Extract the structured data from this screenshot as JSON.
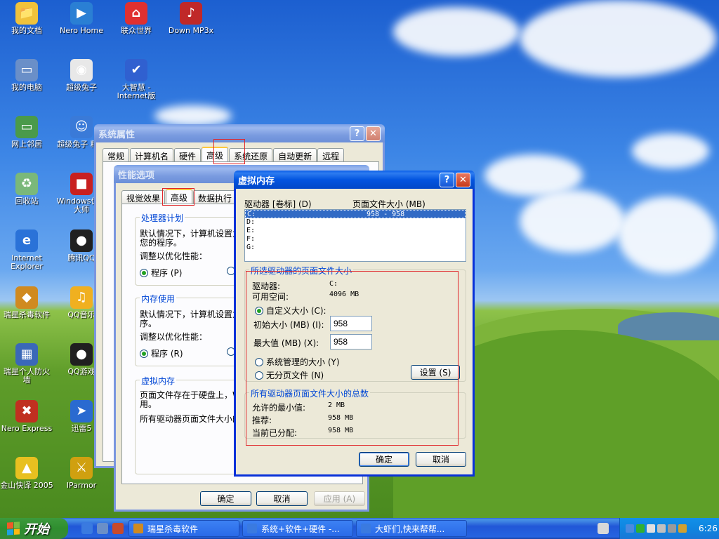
{
  "desktop": {
    "icons": [
      {
        "label": "我的文档",
        "symbol": "📁",
        "color": "#f0c23b"
      },
      {
        "label": "Nero Home",
        "symbol": "▶",
        "color": "#2a7fd4"
      },
      {
        "label": "联众世界",
        "symbol": "⌂",
        "color": "#e03030"
      },
      {
        "label": "Down MP3x",
        "symbol": "♪",
        "color": "#c02828"
      },
      {
        "label": "我的电脑",
        "symbol": "▭",
        "color": "#6a8fc8"
      },
      {
        "label": "超级兔子",
        "symbol": "◉",
        "color": "#e8e8e8"
      },
      {
        "label": "大智慧 -Internet版",
        "symbol": "✔",
        "color": "#3060d0"
      },
      {
        "label": "网上邻居",
        "symbol": "▭",
        "color": "#4a9a4a"
      },
      {
        "label": "超级兔子 精灵",
        "symbol": "☺",
        "color": "#3a7ad8"
      },
      {
        "label": "回收站",
        "symbol": "♻",
        "color": "#7ab87a"
      },
      {
        "label": "Windows优化 大师",
        "symbol": "■",
        "color": "#c82020"
      },
      {
        "label": "Internet Explorer",
        "symbol": "e",
        "color": "#2a72d8"
      },
      {
        "label": "腾讯QQ",
        "symbol": "●",
        "color": "#202020"
      },
      {
        "label": "瑞星杀毒软件",
        "symbol": "◆",
        "color": "#d08a20"
      },
      {
        "label": "QQ音乐",
        "symbol": "♫",
        "color": "#f0b020"
      },
      {
        "label": "瑞星个人防火 墙",
        "symbol": "▦",
        "color": "#3a68b8"
      },
      {
        "label": "QQ游戏",
        "symbol": "●",
        "color": "#202020"
      },
      {
        "label": "Nero Express",
        "symbol": "✖",
        "color": "#c03020"
      },
      {
        "label": "迅雷5",
        "symbol": "➤",
        "color": "#2a6ad0"
      },
      {
        "label": "金山快译 2005",
        "symbol": "▲",
        "color": "#e8c020"
      },
      {
        "label": "IParmor",
        "symbol": "⚔",
        "color": "#d0a010"
      }
    ]
  },
  "sysprops": {
    "title": "系统属性",
    "help": "?",
    "close": "✕",
    "tabs": [
      "常规",
      "计算机名",
      "硬件",
      "高级",
      "系统还原",
      "自动更新",
      "远程"
    ]
  },
  "perf": {
    "title": "性能选项",
    "tabs": [
      "视觉效果",
      "高级",
      "数据执行"
    ],
    "cpu": {
      "heading": "处理器计划",
      "desc1": "默认情况下，计算机设置为",
      "desc2": "您的程序。",
      "adjust": "调整以优化性能：",
      "option": "程序 (P)"
    },
    "mem": {
      "heading": "内存使用",
      "desc1": "默认情况下，计算机设置为",
      "desc2": "序。",
      "adjust": "调整以优化性能：",
      "option": "程序 (R)"
    },
    "vm": {
      "heading": "虚拟内存",
      "desc1": "页面文件存在于硬盘上，W",
      "desc2": "用。",
      "total": "所有驱动器页面文件大小的"
    },
    "ok": "确定",
    "cancel": "取消",
    "apply": "应用 (A)"
  },
  "vmem": {
    "title": "虚拟内存",
    "help": "?",
    "close": "✕",
    "col_drive": "驱动器 [卷标] (D)",
    "col_size": "页面文件大小 (MB)",
    "drives": [
      {
        "drive": "C:",
        "size": "958 - 958"
      },
      {
        "drive": "D:",
        "size": ""
      },
      {
        "drive": "E:",
        "size": ""
      },
      {
        "drive": "F:",
        "size": ""
      },
      {
        "drive": "G:",
        "size": ""
      }
    ],
    "selected": {
      "heading": "所选驱动器的页面文件大小",
      "drive_label": "驱动器:",
      "drive_value": "C:",
      "free_label": "可用空间:",
      "free_value": "4096 MB",
      "custom": "自定义大小 (C):",
      "initial_label": "初始大小 (MB) (I):",
      "initial_value": "958",
      "max_label": "最大值 (MB) (X):",
      "max_value": "958",
      "system_managed": "系统管理的大小 (Y)",
      "no_paging": "无分页文件 (N)",
      "set": "设置 (S)"
    },
    "totals": {
      "heading": "所有驱动器页面文件大小的总数",
      "min_label": "允许的最小值:",
      "min_value": "2 MB",
      "rec_label": "推荐:",
      "rec_value": "958 MB",
      "cur_label": "当前已分配:",
      "cur_value": "958 MB"
    },
    "ok": "确定",
    "cancel": "取消"
  },
  "taskbar": {
    "start": "开始",
    "tasks": [
      "瑞星杀毒软件",
      "系统+软件+硬件 -...",
      "大虾们,快来帮帮..."
    ],
    "clock": "6:26"
  }
}
